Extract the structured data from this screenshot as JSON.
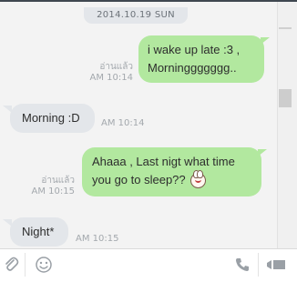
{
  "chat": {
    "date": "2014.10.19 SUN",
    "messages": [
      {
        "side": "right",
        "lines": [
          "i wake up late :3 ,",
          "Morninggggggg.."
        ],
        "read_label": "อ่านแล้ว",
        "time": "AM 10:14"
      },
      {
        "side": "left",
        "lines": [
          "Morning :D"
        ],
        "time": "AM 10:14"
      },
      {
        "side": "right",
        "lines": [
          "Ahaaa ,  Last nigt what time",
          "you go to sleep??"
        ],
        "read_label": "อ่านแล้ว",
        "time": "AM 10:15",
        "sticker_icon": "bunny-emoji-icon"
      },
      {
        "side": "left",
        "lines": [
          "Night*"
        ],
        "time": "AM 10:15"
      }
    ]
  },
  "colors": {
    "outgoing_bubble": "#b2e89f",
    "incoming_bubble": "#e3e6ea",
    "chat_background": "#f3f3f3",
    "meta_text": "#a3a8ad"
  },
  "toolbar": {
    "icons": [
      "paperclip-icon",
      "smiley-icon",
      "phone-icon",
      "video-call-icon"
    ]
  }
}
